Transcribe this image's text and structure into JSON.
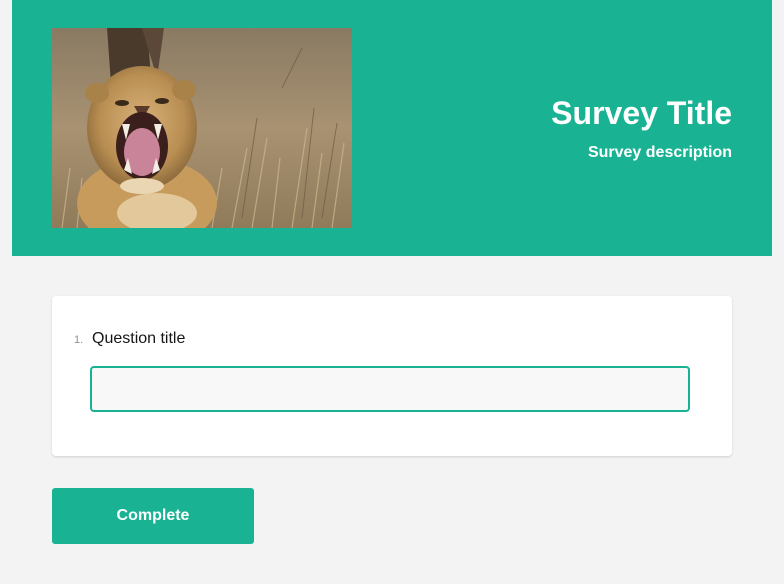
{
  "header": {
    "title": "Survey Title",
    "description": "Survey description",
    "logo_icon": "lion-logo-image",
    "background_color": "#19b394"
  },
  "questions": [
    {
      "number": "1.",
      "title": "Question title",
      "value": "",
      "placeholder": ""
    }
  ],
  "navigation": {
    "complete_label": "Complete"
  },
  "colors": {
    "accent": "#19b394",
    "page_background": "#f3f3f3",
    "text": "#161616"
  }
}
